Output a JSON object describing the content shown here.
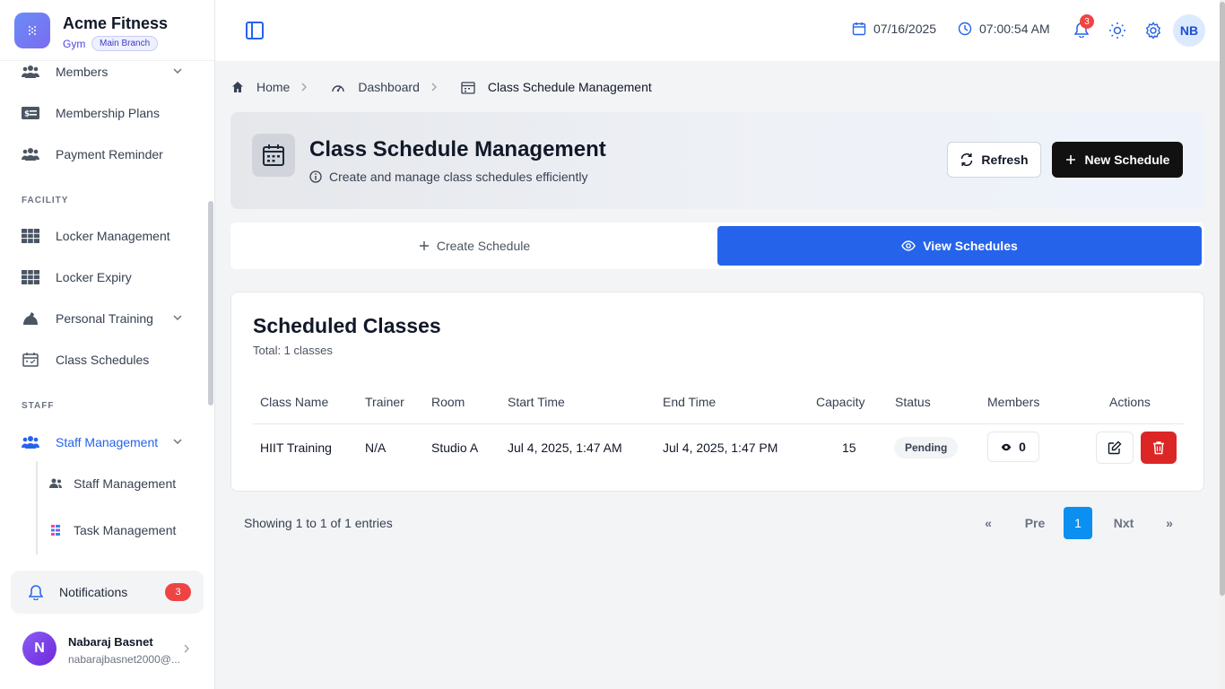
{
  "brand": {
    "name": "Acme Fitness",
    "sub": "Gym",
    "badge": "Main Branch"
  },
  "sidebar": {
    "items": [
      {
        "label": "Members",
        "icon": "users-icon",
        "chevron": true
      },
      {
        "label": "Membership Plans",
        "icon": "money-icon"
      },
      {
        "label": "Payment Reminder",
        "icon": "users-icon"
      },
      {
        "label": "Locker Management",
        "icon": "locker-icon"
      },
      {
        "label": "Locker Expiry",
        "icon": "locker-icon"
      },
      {
        "label": "Personal Training",
        "icon": "dumbbell-icon",
        "chevron": true
      },
      {
        "label": "Class Schedules",
        "icon": "calendar-check-icon"
      },
      {
        "label": "Staff Management",
        "icon": "users-icon",
        "chevron": true,
        "active": true
      }
    ],
    "sections": {
      "facility": "FACILITY",
      "staff": "STAFF"
    },
    "subitems": [
      {
        "label": "Staff Management",
        "icon": "users-icon"
      },
      {
        "label": "Task Management",
        "icon": "tasks-icon"
      }
    ],
    "notifications": {
      "label": "Notifications",
      "count": "3"
    },
    "user": {
      "initial": "N",
      "name": "Nabaraj Basnet",
      "email": "nabarajbasnet2000@..."
    }
  },
  "topbar": {
    "date": "07/16/2025",
    "time": "07:00:54 AM",
    "bell_count": "3",
    "avatar": "NB"
  },
  "breadcrumb": {
    "home": "Home",
    "dashboard": "Dashboard",
    "current": "Class Schedule Management"
  },
  "header": {
    "title": "Class Schedule Management",
    "subtitle": "Create and manage class schedules efficiently",
    "refresh": "Refresh",
    "new": "New Schedule"
  },
  "tabs": {
    "create": "Create Schedule",
    "view": "View Schedules"
  },
  "table": {
    "title": "Scheduled Classes",
    "total": "Total: 1 classes",
    "columns": [
      "Class Name",
      "Trainer",
      "Room",
      "Start Time",
      "End Time",
      "Capacity",
      "Status",
      "Members",
      "Actions"
    ],
    "rows": [
      {
        "class_name": "HIIT Training",
        "trainer": "N/A",
        "room": "Studio A",
        "start": "Jul 4, 2025, 1:47 AM",
        "end": "Jul 4, 2025, 1:47 PM",
        "capacity": "15",
        "status": "Pending",
        "members": "0"
      }
    ]
  },
  "pagination": {
    "showing": "Showing 1 to 1 of 1 entries",
    "first": "«",
    "prev": "Pre",
    "page": "1",
    "next": "Nxt",
    "last": "»"
  },
  "colors": {
    "primary": "#2563eb",
    "danger": "#dc2626",
    "dark": "#111111",
    "page_active": "#0b8ff0"
  }
}
